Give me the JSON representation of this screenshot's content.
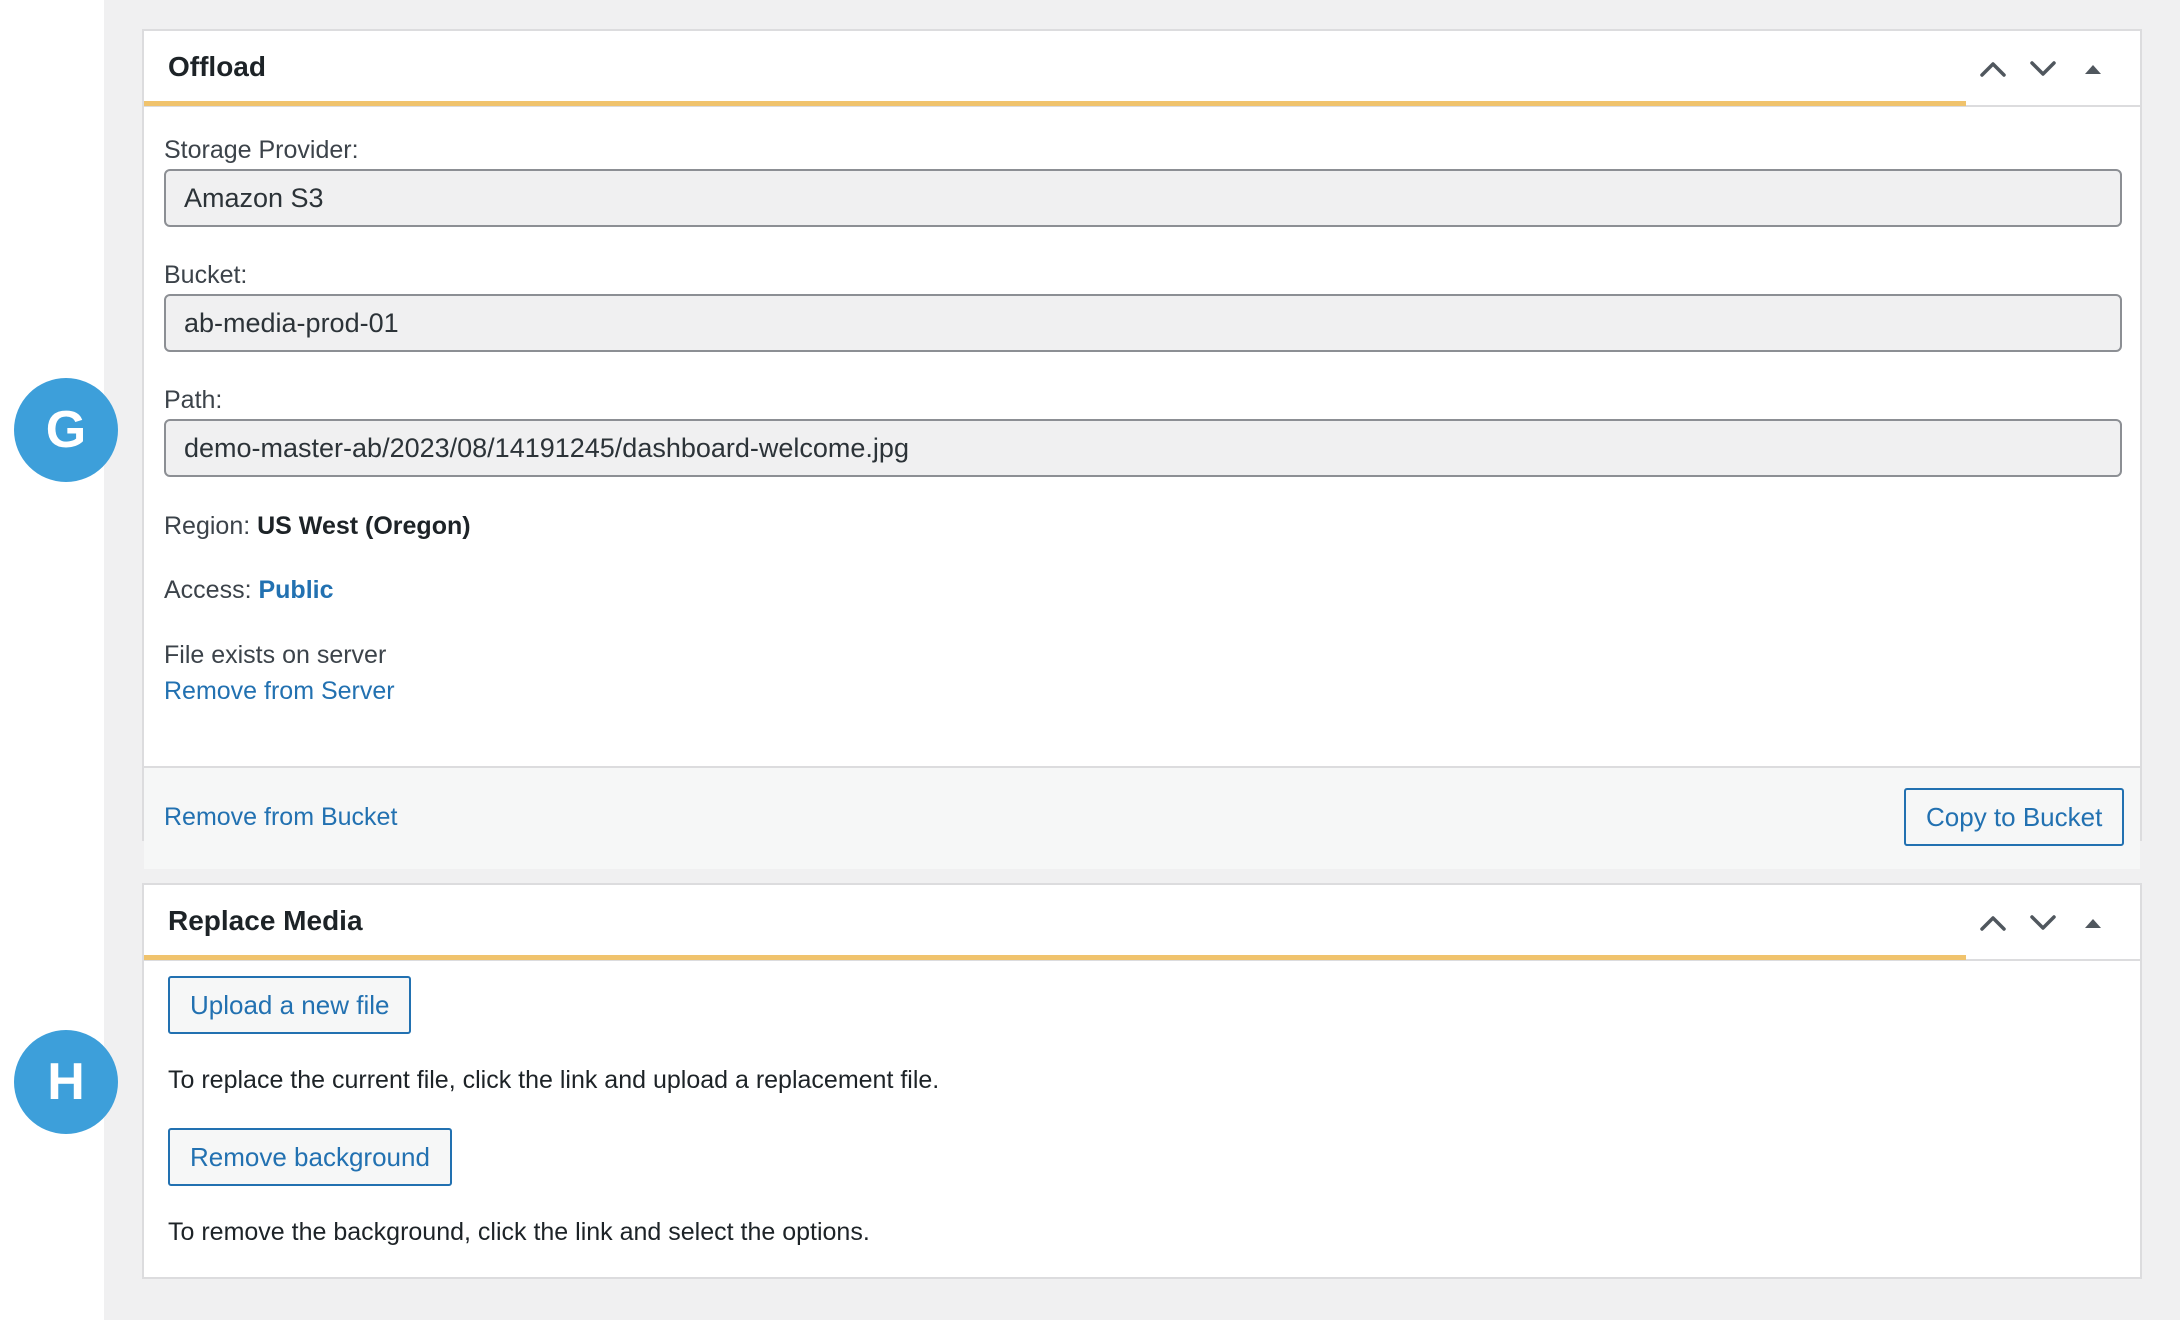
{
  "markers": {
    "g": "G",
    "h": "H"
  },
  "offload": {
    "title": "Offload",
    "controls": {
      "move_up_icon": "chevron-up-icon",
      "move_down_icon": "chevron-down-icon",
      "toggle_icon": "caret-up-icon"
    },
    "storage_provider_label": "Storage Provider:",
    "storage_provider_value": "Amazon S3",
    "bucket_label": "Bucket:",
    "bucket_value": "ab-media-prod-01",
    "path_label": "Path:",
    "path_value": "demo-master-ab/2023/08/14191245/dashboard-welcome.jpg",
    "region_label": "Region:",
    "region_value": "US West (Oregon)",
    "access_label": "Access:",
    "access_value": "Public",
    "file_status": "File exists on server",
    "remove_from_server": "Remove from Server",
    "remove_from_bucket": "Remove from Bucket",
    "copy_to_bucket": "Copy to Bucket"
  },
  "replace_media": {
    "title": "Replace Media",
    "upload_button": "Upload a new file",
    "upload_description": "To replace the current file, click the link and upload a replacement file.",
    "remove_background_button": "Remove background",
    "remove_background_description": "To remove the background, click the link and select the options."
  },
  "colors": {
    "accent_underline": "#f0c36d",
    "link": "#2271b1",
    "marker": "#3d9fda",
    "canvas": "#f0f0f1"
  }
}
